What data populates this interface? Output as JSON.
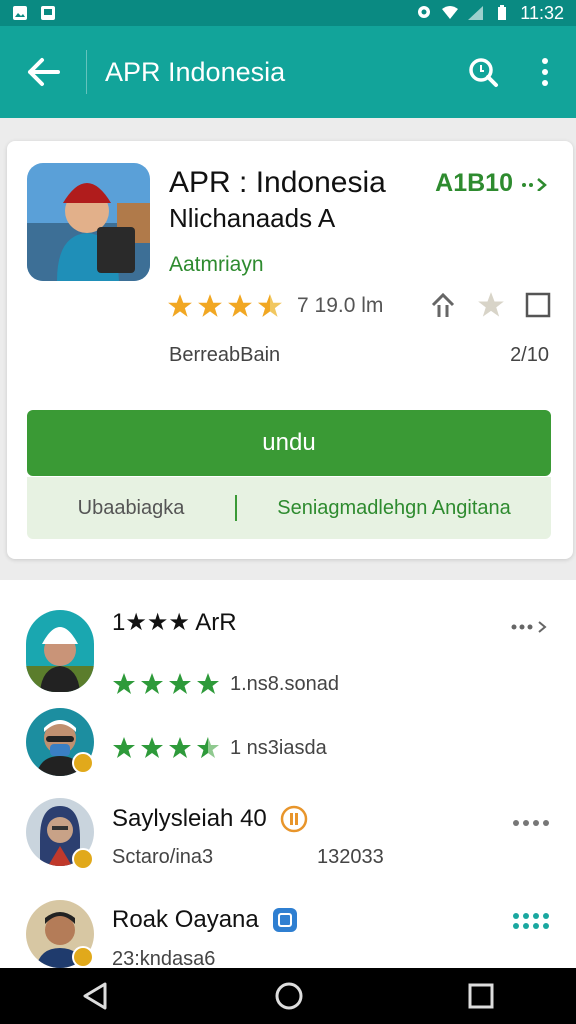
{
  "status": {
    "time": "11:32"
  },
  "appbar": {
    "title": "APR Indonesia"
  },
  "app": {
    "name": "APR : Indonesia",
    "subtitle": "Nlichanaads A",
    "developer": "Aatmriayn",
    "top_right": "A1B10",
    "rating_text": "7 19.0 lm",
    "meta_left": "BerreabBain",
    "meta_right": "2/10",
    "install_label": "undu",
    "sub_left": "Ubaabiagka",
    "sub_right": "Seniagmadlehgn Angitana"
  },
  "list": [
    {
      "title": "1★★★ ArR",
      "line": "1.ns8.sonad"
    },
    {
      "title": "",
      "line": "1 ns3iasda"
    },
    {
      "title": "Saylysleiah 40",
      "line": "Sctaro/ina3",
      "line_value": "132033"
    },
    {
      "title": "Roak Oayana",
      "line": "23:kndasa6"
    }
  ],
  "colors": {
    "teal": "#12a49a",
    "green": "#3a9a35",
    "gold": "#e1a91b"
  }
}
